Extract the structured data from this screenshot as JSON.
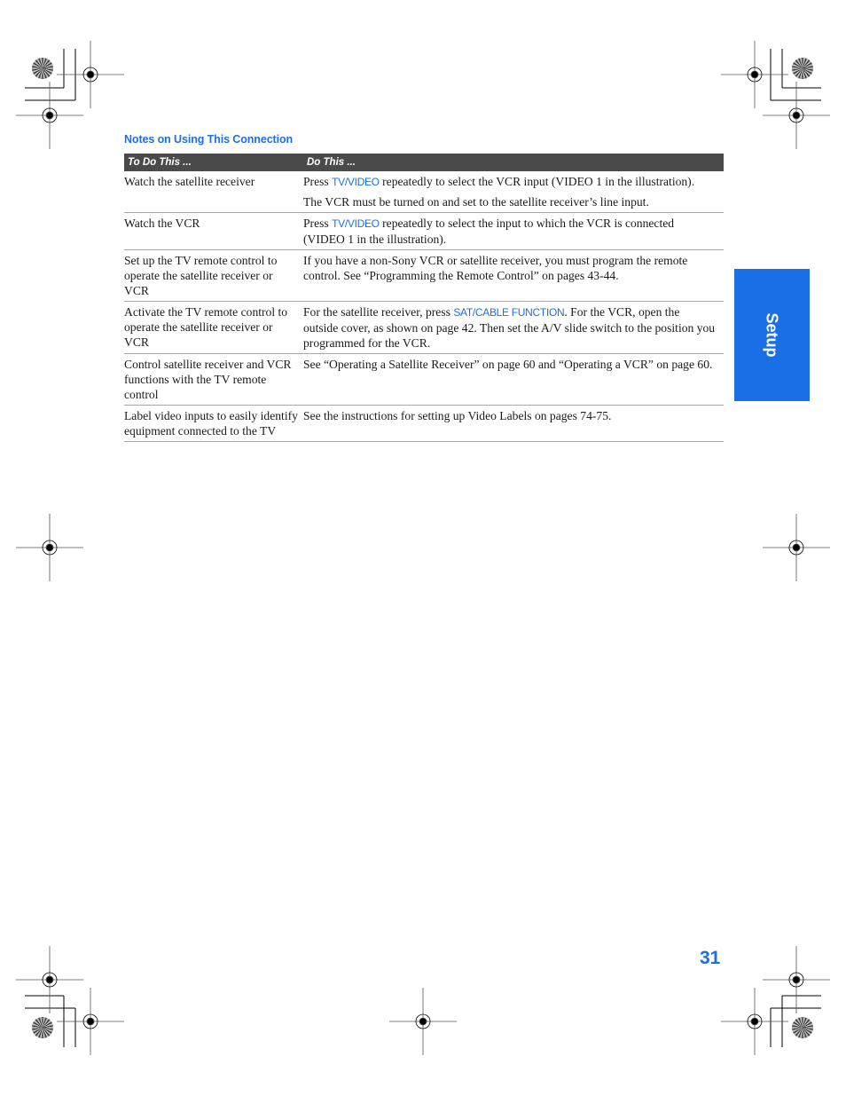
{
  "section": {
    "title": "Notes on Using This Connection"
  },
  "table": {
    "headers": [
      "To Do This ...",
      "Do This ..."
    ],
    "rows": [
      {
        "task": "Watch the satellite receiver",
        "paragraphs": [
          {
            "pre": "Press ",
            "button": "TV/VIDEO",
            "post": " repeatedly to select the VCR input (VIDEO 1 in the illustration)."
          },
          {
            "pre": "The VCR must be turned on and set to the satellite receiver’s line input.",
            "button": "",
            "post": ""
          }
        ]
      },
      {
        "task": "Watch the VCR",
        "paragraphs": [
          {
            "pre": "Press ",
            "button": "TV/VIDEO",
            "post": " repeatedly to select the input to which the VCR is connected (VIDEO 1 in the illustration)."
          }
        ]
      },
      {
        "task": "Set up the TV remote control to operate the satellite receiver or VCR",
        "paragraphs": [
          {
            "pre": "If you have a non-Sony VCR or satellite receiver, you must program the remote control. See “Programming the Remote Control” on pages 43-44.",
            "button": "",
            "post": ""
          }
        ]
      },
      {
        "task": "Activate the TV remote control to operate the satellite receiver or VCR",
        "paragraphs": [
          {
            "pre": "For the satellite receiver, press ",
            "button": "SAT/CABLE FUNCTION",
            "post": ". For the VCR, open the outside cover, as shown on page 42. Then set the A/V slide switch to the position you programmed for the VCR."
          }
        ]
      },
      {
        "task": "Control satellite receiver and VCR functions with the TV remote control",
        "paragraphs": [
          {
            "pre": "See “Operating a Satellite Receiver” on page 60 and “Operating a VCR” on page 60.",
            "button": "",
            "post": ""
          }
        ]
      },
      {
        "task": "Label video inputs to easily identify equipment connected to the TV",
        "paragraphs": [
          {
            "pre": "See the instructions for setting up Video Labels on pages 74-75.",
            "button": "",
            "post": ""
          }
        ]
      }
    ]
  },
  "side_tab": {
    "label": "Setup",
    "color": "#1a6fe6"
  },
  "page_number": "31",
  "colors": {
    "accent": "#1a6fe6",
    "header_bg": "#4a4a4a",
    "rule": "#a8a8a8"
  }
}
